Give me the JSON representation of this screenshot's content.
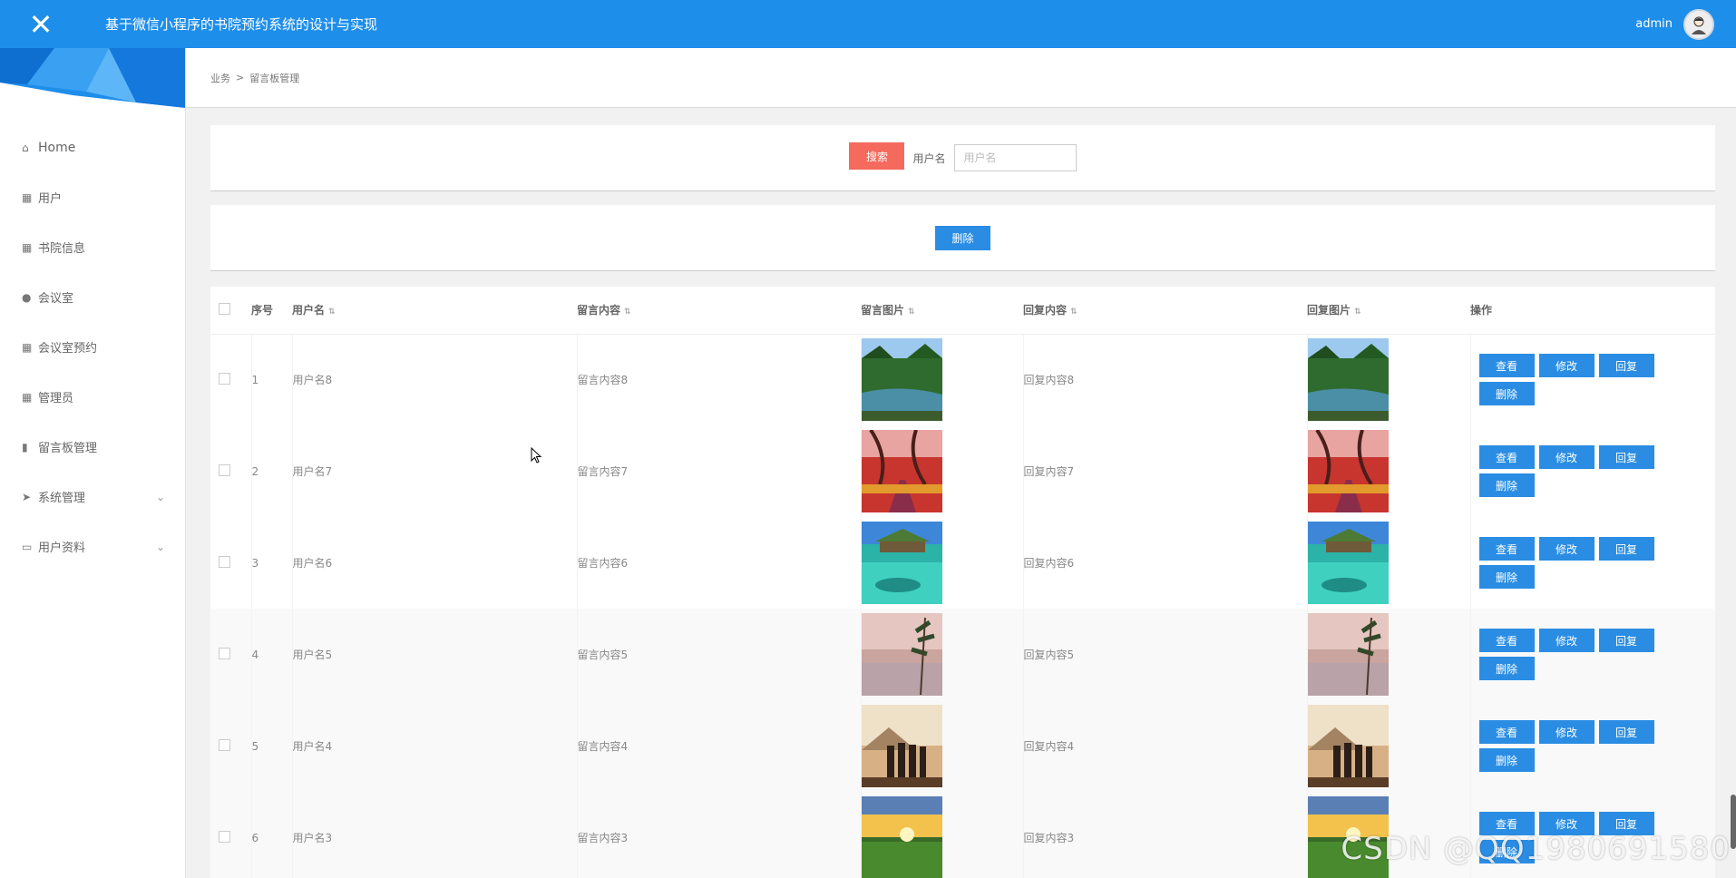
{
  "header": {
    "title": "基于微信小程序的书院预约系统的设计与实现",
    "username": "admin"
  },
  "sidebar": {
    "items": [
      {
        "label": "Home",
        "icon": "home-icon"
      },
      {
        "label": "用户",
        "icon": "grid-icon"
      },
      {
        "label": "书院信息",
        "icon": "grid-icon"
      },
      {
        "label": "会议室",
        "icon": "pin-icon"
      },
      {
        "label": "会议室预约",
        "icon": "grid-icon"
      },
      {
        "label": "管理员",
        "icon": "grid-icon"
      },
      {
        "label": "留言板管理",
        "icon": "clipboard-icon"
      },
      {
        "label": "系统管理",
        "icon": "send-icon"
      },
      {
        "label": "用户资料",
        "icon": "card-icon"
      }
    ]
  },
  "breadcrumb": {
    "parent": "业务",
    "separator": ">",
    "current": "留言板管理"
  },
  "search": {
    "button": "搜索",
    "label": "用户名",
    "placeholder": "用户名"
  },
  "actions": {
    "delete": "删除"
  },
  "table": {
    "headers": {
      "index": "序号",
      "username": "用户名",
      "content": "留言内容",
      "image": "留言图片",
      "reply": "回复内容",
      "reply_image": "回复图片",
      "ops": "操作"
    },
    "ops": {
      "view": "查看",
      "edit": "修改",
      "reply": "回复",
      "delete": "删除"
    },
    "rows": [
      {
        "index": "1",
        "username": "用户名8",
        "content": "留言内容8",
        "reply": "回复内容8",
        "image": "forest-river"
      },
      {
        "index": "2",
        "username": "用户名7",
        "content": "留言内容7",
        "reply": "回复内容7",
        "image": "red-autumn-path"
      },
      {
        "index": "3",
        "username": "用户名6",
        "content": "留言内容6",
        "reply": "回复内容6",
        "image": "tropical-huts"
      },
      {
        "index": "4",
        "username": "用户名5",
        "content": "留言内容5",
        "reply": "回复内容5",
        "image": "misty-pine"
      },
      {
        "index": "5",
        "username": "用户名4",
        "content": "留言内容4",
        "reply": "回复内容4",
        "image": "people-sunset"
      },
      {
        "index": "6",
        "username": "用户名3",
        "content": "留言内容3",
        "reply": "回复内容3",
        "image": "sunset-fields"
      }
    ]
  },
  "watermark": "CSDN @QQ1980691580",
  "colors": {
    "topbar": "#1e8eeb",
    "search_button": "#f46a5c",
    "action_button": "#2a8de3"
  }
}
